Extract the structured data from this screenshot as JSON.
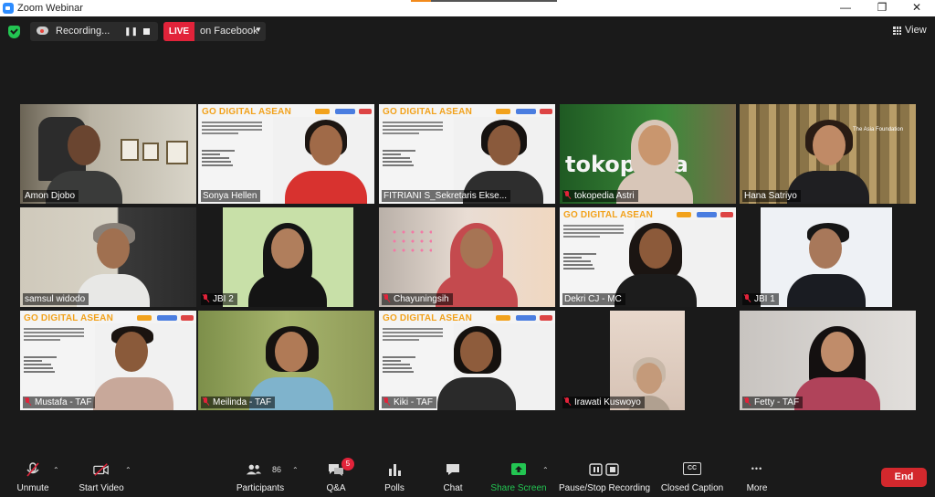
{
  "window": {
    "title": "Zoom Webinar",
    "minimize_glyph": "—",
    "maximize_glyph": "❐",
    "close_glyph": "✕"
  },
  "topbar": {
    "recording_status": "Recording...",
    "pause_glyph": "❚❚",
    "live_badge": "LIVE",
    "live_target": "on Facebook",
    "live_caret": "▼",
    "view_label": "View"
  },
  "slide": {
    "title": "GO DIGITAL ASEAN",
    "lines": [
      "Perluasan Kesempatan Ekonomi",
      "melalui Peningkatan Kemampuan",
      "Penguasaan Teknologi, Informasi,",
      "dan Komunikasi"
    ],
    "tags": [
      "#GoDigitalASEAN",
      "#ASEAN",
      "#digitalskills",
      "#digitalliteracy",
      "#digitaleconomy"
    ]
  },
  "participants": [
    {
      "name": "Amon Djobo",
      "muted": false,
      "active": false
    },
    {
      "name": "Sonya Hellen",
      "muted": false,
      "active": true
    },
    {
      "name": "FITRIANI S_Sekretaris Ekse...",
      "muted": false,
      "active": false
    },
    {
      "name": "tokopedia Astri",
      "muted": true,
      "active": false
    },
    {
      "name": "Hana Satriyo",
      "muted": false,
      "active": false
    },
    {
      "name": "samsul widodo",
      "muted": false,
      "active": false
    },
    {
      "name": "JBI 2",
      "muted": true,
      "active": false
    },
    {
      "name": "Chayuningsih",
      "muted": true,
      "active": false
    },
    {
      "name": "Dekri CJ - MC",
      "muted": false,
      "active": false
    },
    {
      "name": "JBI 1",
      "muted": true,
      "active": false
    },
    {
      "name": "Mustafa - TAF",
      "muted": true,
      "active": false
    },
    {
      "name": "Meilinda - TAF",
      "muted": true,
      "active": false
    },
    {
      "name": "Kiki - TAF",
      "muted": true,
      "active": false
    },
    {
      "name": "Irawati Kuswoyo",
      "muted": true,
      "active": false
    },
    {
      "name": "Fetty - TAF",
      "muted": true,
      "active": false
    }
  ],
  "tile_backgrounds": {
    "tokopedia_sign": "tokopedia",
    "foundation_label": "The Asia Foundation"
  },
  "toolbar": {
    "unmute": "Unmute",
    "start_video": "Start Video",
    "participants": "Participants",
    "participants_count": "86",
    "qa": "Q&A",
    "qa_badge": "5",
    "polls": "Polls",
    "chat": "Chat",
    "share_screen": "Share Screen",
    "recording": "Pause/Stop Recording",
    "closed_caption": "Closed Caption",
    "cc_glyph": "CC",
    "more": "More",
    "more_glyph": "•••",
    "caret_glyph": "⌃",
    "end": "End"
  },
  "colors": {
    "accent_green": "#23c552",
    "live_red": "#e2233a",
    "end_red": "#d3282d",
    "active_speaker": "#e3e32a",
    "slide_title": "#f2a21c"
  }
}
